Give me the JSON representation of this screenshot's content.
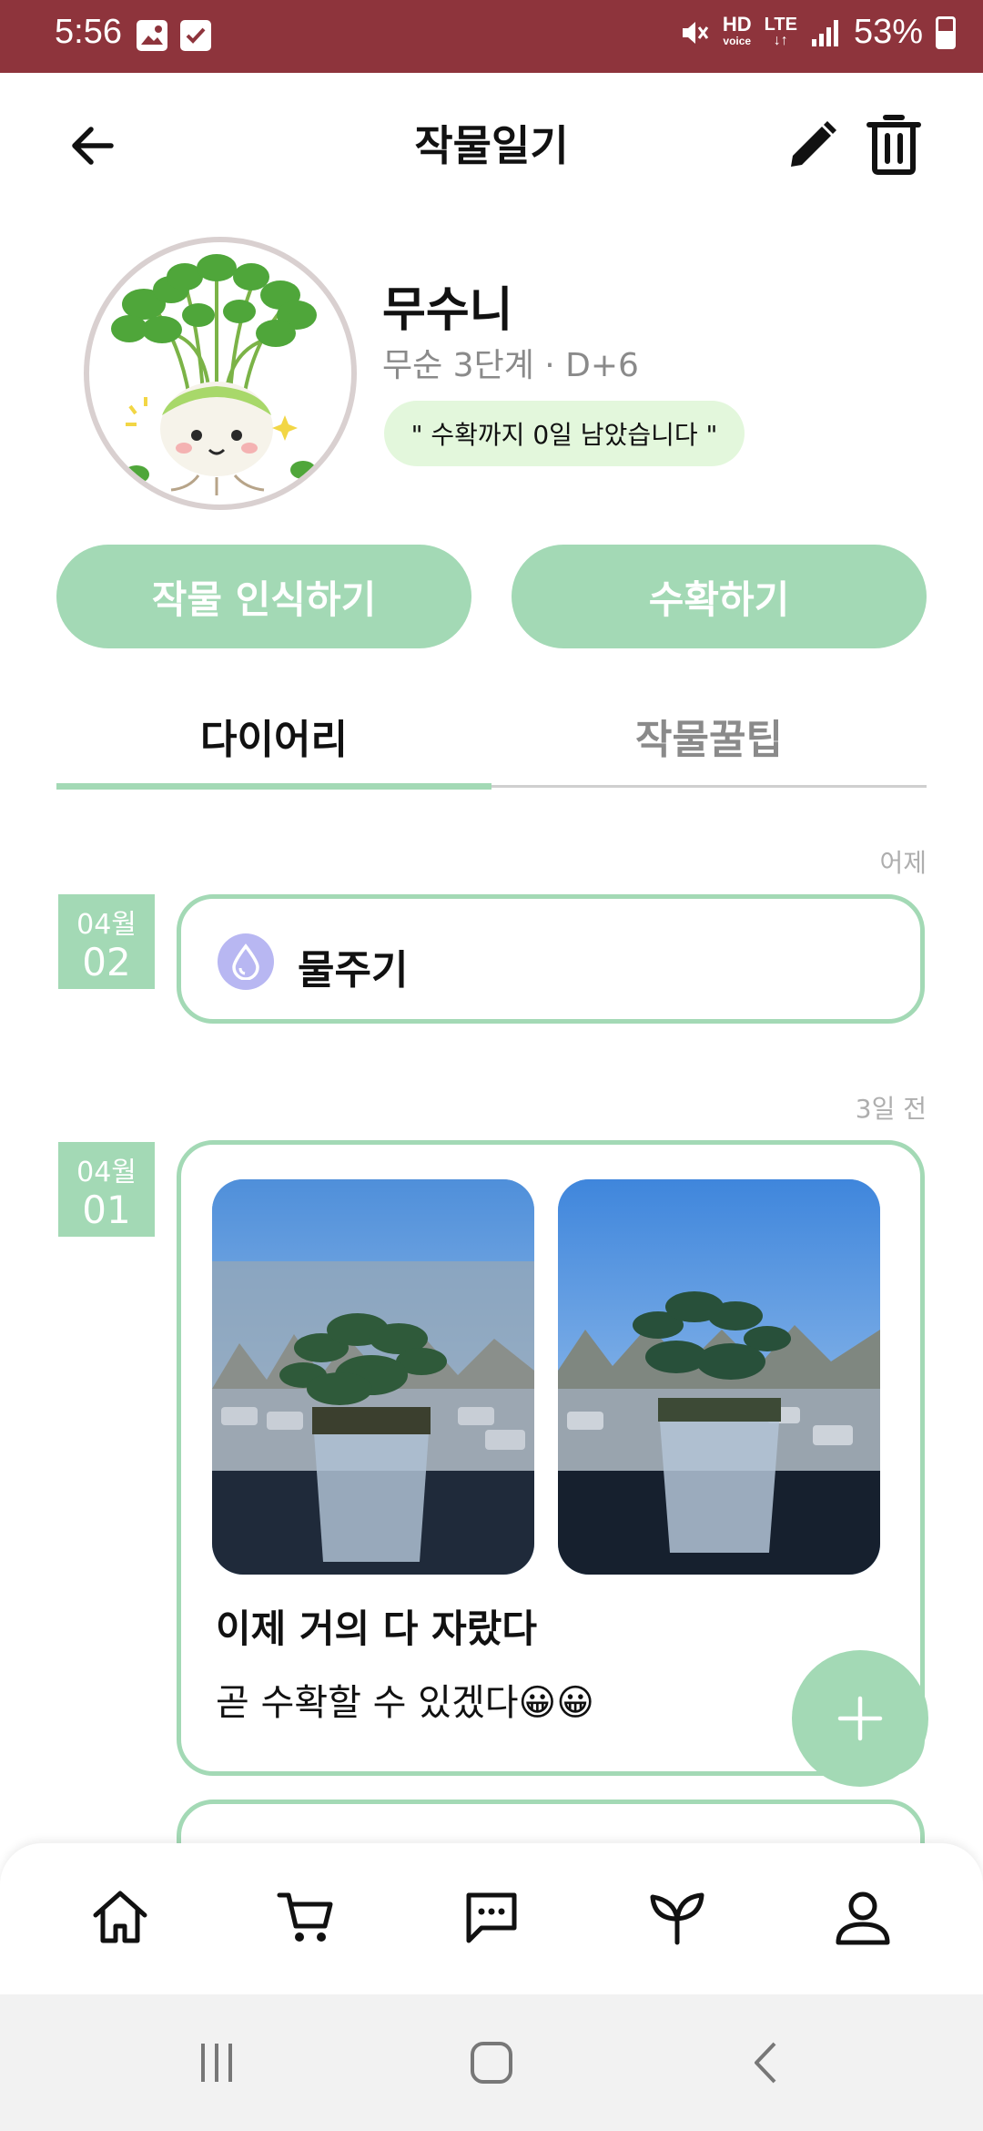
{
  "status_bar": {
    "time": "5:56",
    "hd_label": "HD",
    "voice_label": "voice",
    "lte_label": "LTE",
    "battery": "53%"
  },
  "header": {
    "title": "작물일기",
    "back_icon": "arrow-left-icon",
    "edit_icon": "pencil-icon",
    "delete_icon": "trash-icon"
  },
  "profile": {
    "name": "무수니",
    "stage": "무순 3단계 · D+6",
    "harvest_message": "\" 수확까지 0일 남았습니다 \""
  },
  "actions": {
    "recognize_label": "작물 인식하기",
    "harvest_label": "수확하기"
  },
  "tabs": [
    {
      "label": "다이어리",
      "active": true
    },
    {
      "label": "작물꿀팁",
      "active": false
    }
  ],
  "entries": [
    {
      "relative_date": "어제",
      "month": "04월",
      "day": "02",
      "type": "watering",
      "label": "물주기"
    },
    {
      "relative_date": "3일 전",
      "month": "04월",
      "day": "01",
      "type": "diary",
      "title": "이제 거의 다 자랐다",
      "text": "곧 수확할 수 있겠다😀😀"
    }
  ],
  "bottom_nav": [
    "home-icon",
    "cart-icon",
    "chat-icon",
    "sprout-icon",
    "profile-icon"
  ],
  "colors": {
    "status_bar": "#8e343c",
    "accent": "#a3d9b5",
    "badge_bg": "#e3f7dc",
    "water_icon": "#b8b7f2"
  }
}
